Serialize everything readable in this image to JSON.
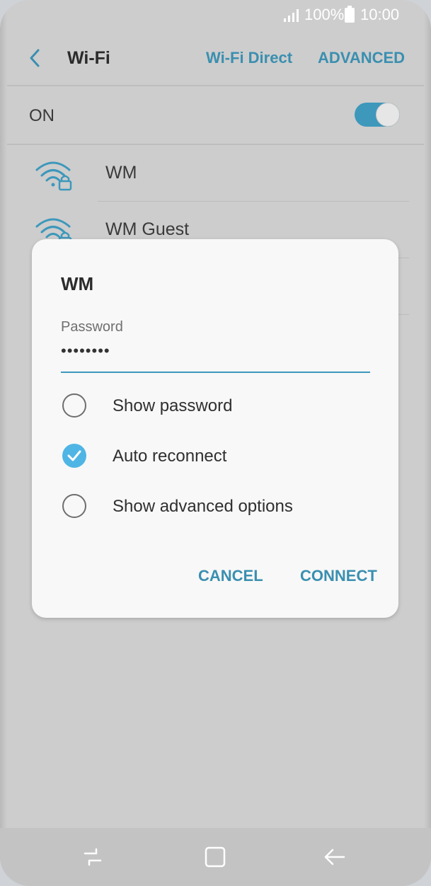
{
  "status_bar": {
    "battery": "100%",
    "time": "10:00"
  },
  "appbar": {
    "title": "Wi-Fi",
    "wifi_direct": "Wi-Fi Direct",
    "advanced": "ADVANCED"
  },
  "master_switch": {
    "label": "ON",
    "state": true
  },
  "networks": [
    {
      "name": "WM",
      "icon": "wifi-lock-icon"
    },
    {
      "name": "WM Guest",
      "icon": "wifi-lock-icon"
    }
  ],
  "dialog": {
    "title": "WM",
    "password_label": "Password",
    "password_value": "••••••••",
    "options": [
      {
        "label": "Show password",
        "checked": false
      },
      {
        "label": "Auto reconnect",
        "checked": true
      },
      {
        "label": "Show advanced options",
        "checked": false
      }
    ],
    "cancel": "CANCEL",
    "connect": "CONNECT"
  },
  "colors": {
    "accent": "#3a8fb0",
    "toggle_on": "#3d98bb",
    "check": "#4fb5e5"
  },
  "nav_icons": [
    "recents-icon",
    "home-icon",
    "back-icon"
  ]
}
